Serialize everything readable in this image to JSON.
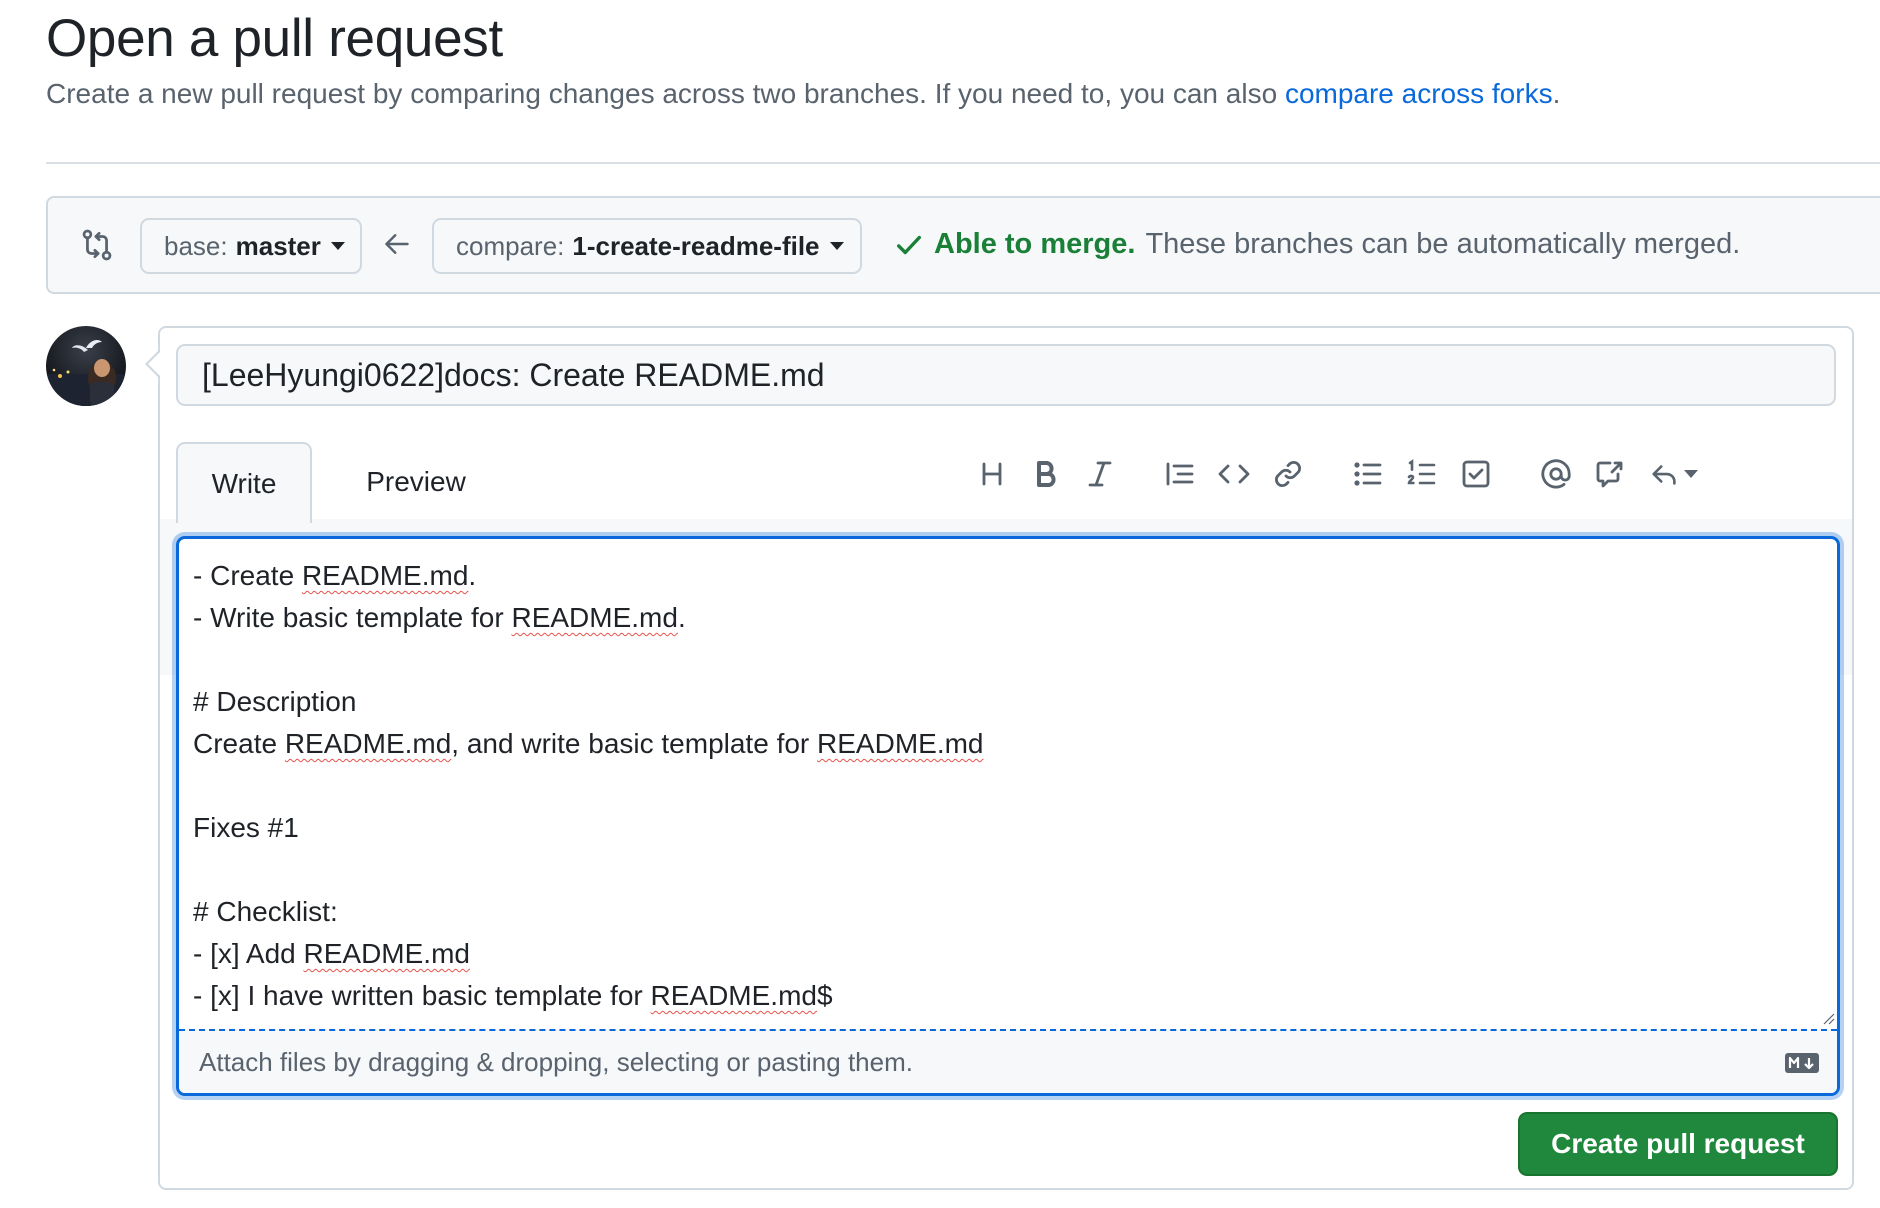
{
  "header": {
    "title": "Open a pull request",
    "subtitle": "Create a new pull request by comparing changes across two branches. If you need to, you can also ",
    "subtitle_link": "compare across forks",
    "subtitle_end": "."
  },
  "range": {
    "base_label": "base:",
    "base_branch": "master",
    "compare_label": "compare:",
    "compare_branch": "1-create-readme-file",
    "merge_status": "Able to merge.",
    "merge_detail": "These branches can be automatically merged.",
    "merge_color": "#1a7f37"
  },
  "form": {
    "title_value": "[LeeHyungi0622]docs: Create README.md",
    "tabs": [
      {
        "label": "Write",
        "selected": true
      },
      {
        "label": "Preview",
        "selected": false
      }
    ],
    "toolbar": [
      {
        "icon": "heading-icon",
        "label": "Heading"
      },
      {
        "icon": "bold-icon",
        "label": "Bold"
      },
      {
        "icon": "italic-icon",
        "label": "Italic"
      },
      {
        "icon": "quote-icon",
        "label": "Quote"
      },
      {
        "icon": "code-icon",
        "label": "Code"
      },
      {
        "icon": "link-icon",
        "label": "Link"
      },
      {
        "icon": "unordered-list-icon",
        "label": "Unordered list"
      },
      {
        "icon": "ordered-list-icon",
        "label": "Numbered list"
      },
      {
        "icon": "task-list-icon",
        "label": "Task list"
      },
      {
        "icon": "mention-icon",
        "label": "Mention"
      },
      {
        "icon": "cross-reference-icon",
        "label": "Reference"
      },
      {
        "icon": "reply-icon",
        "label": "Saved replies"
      }
    ],
    "body_lines": [
      "- Create README.md.",
      "- Write basic template for README.md.",
      "",
      "# Description",
      "Create README.md, and write basic template for README.md",
      "",
      "Fixes #1",
      "",
      "# Checklist:",
      "- [x] Add README.md",
      "- [x] I have written basic template for README.md$"
    ],
    "attach_hint": "Attach files by dragging & dropping, selecting or pasting them.",
    "markdown_icon": "markdown-icon",
    "submit_label": "Create pull request",
    "submit_color": "#1f883d"
  }
}
